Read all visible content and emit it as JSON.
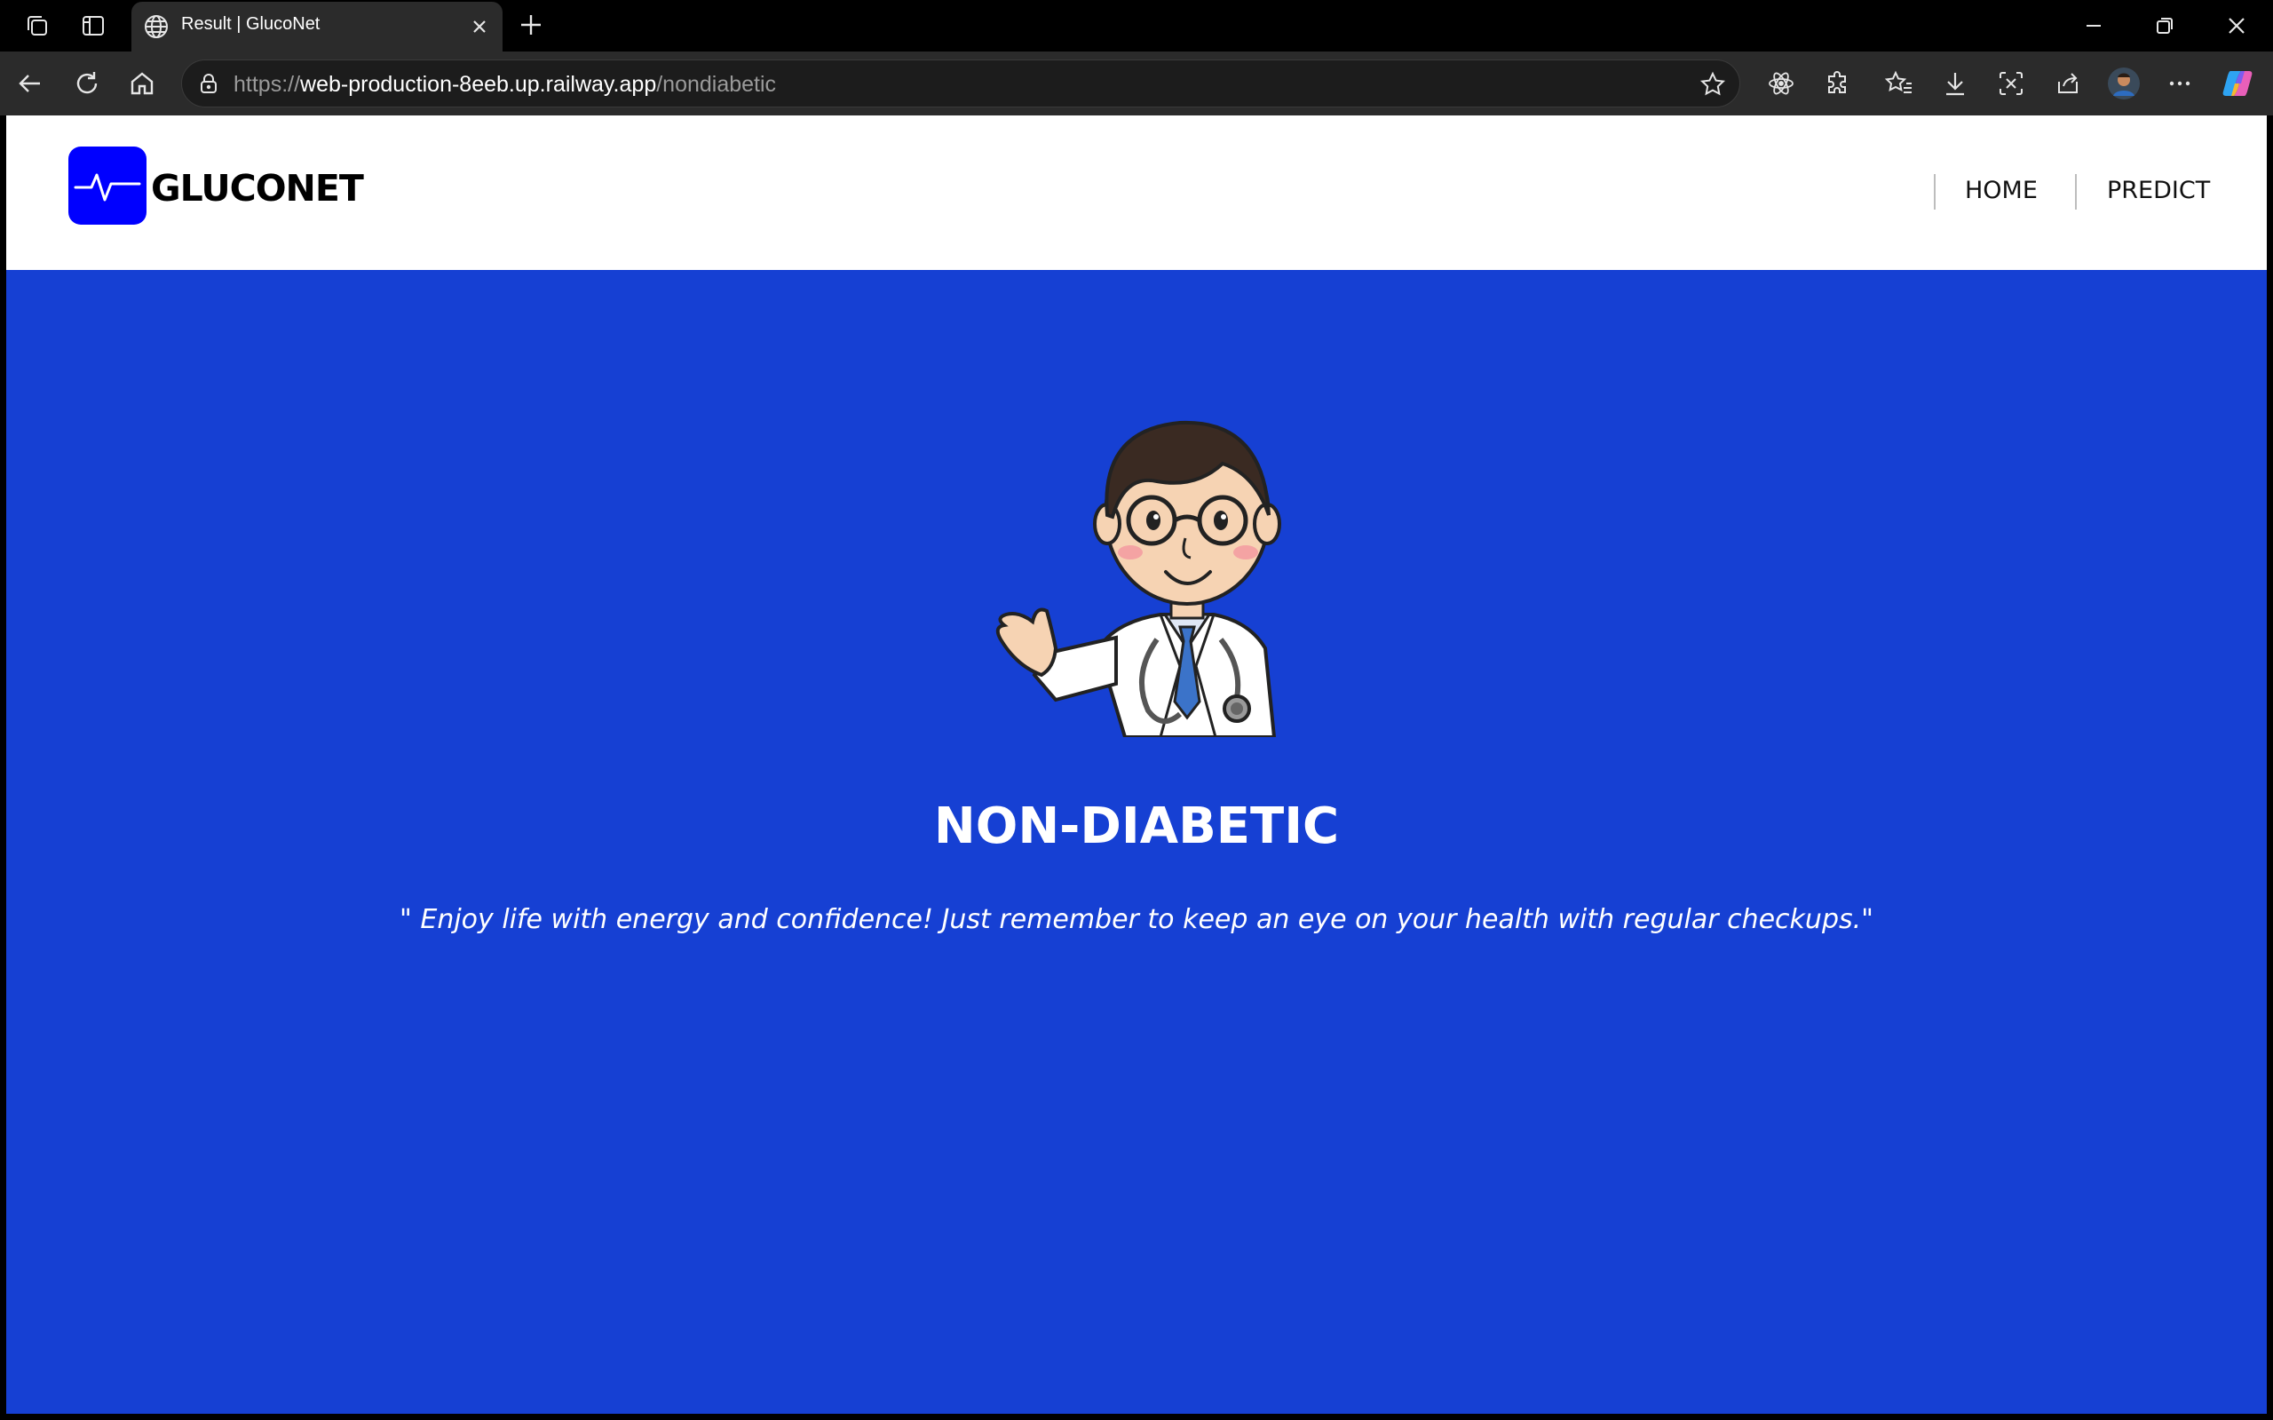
{
  "browser": {
    "tab_title": "Result | GlucoNet",
    "url_scheme": "https://",
    "url_host": "web-production-8eeb.up.railway.app",
    "url_path": "/nondiabetic"
  },
  "site": {
    "brand": "GLUCONET",
    "nav": [
      {
        "label": "HOME"
      },
      {
        "label": "PREDICT"
      }
    ],
    "result_title": "NON-DIABETIC",
    "quote": "\" Enjoy life with energy and confidence! Just remember to keep an eye on your health with regular checkups.\""
  },
  "colors": {
    "page_background": "#1640d3",
    "logo_background": "#0000ff",
    "header_background": "#ffffff"
  },
  "icons": {
    "logo": "heartbeat-pulse-icon",
    "illustration": "cartoon-doctor"
  }
}
